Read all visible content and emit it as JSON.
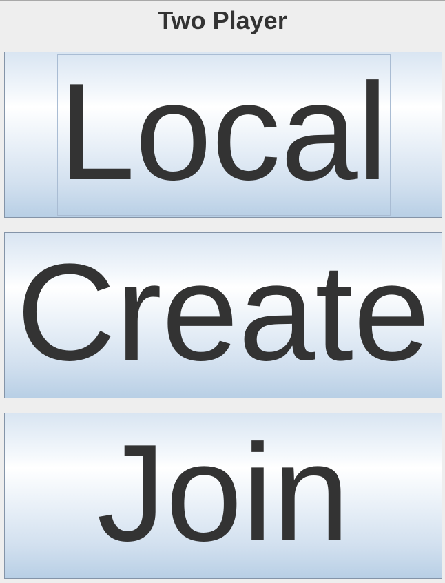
{
  "title": "Two Player",
  "buttons": [
    {
      "label": "Local",
      "focused": true
    },
    {
      "label": "Create"
    },
    {
      "label": "Join"
    }
  ],
  "colors": {
    "text": "#333333",
    "background": "#eeeeee",
    "border": "#8494a8"
  }
}
